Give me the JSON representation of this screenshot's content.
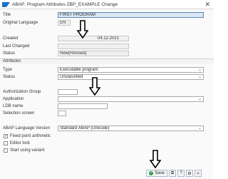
{
  "window": {
    "title": "ABAP: Program Attributes ZBP_EXAMPLE Change",
    "close": "✕"
  },
  "header": {
    "title_label": "Title",
    "title_value": "FIRST PROGRAM",
    "orig_lang_label": "Original Language",
    "orig_lang_value": "EN",
    "created_label": "Created",
    "created_date": "04.12.2021",
    "last_changed_label": "Last Changed",
    "status_label": "Status",
    "status_value": "New(Revised)"
  },
  "attributes": {
    "section_label": "Attributes",
    "type_label": "Type",
    "type_value": "Executable program",
    "status_label": "Status",
    "status_value": "Unclassified",
    "auth_group_label": "Authorization Group",
    "application_label": "Application",
    "ldb_label": "LDB name",
    "selection_screen_label": "Selection screen",
    "abap_version_label": "ABAP Language Version",
    "abap_version_value": "Standard ABAP (Unicode)",
    "fixed_point_label": "Fixed point arithmetic",
    "editor_lock_label": "Editor lock",
    "start_variant_label": "Start using variant"
  },
  "footer": {
    "save_label": "Save"
  },
  "colors": {
    "accent": "#5b89b7",
    "title_field_bg": "#dbe7f3",
    "save_check": "#2e9c3f"
  },
  "icons": [
    "sap-logo-icon",
    "close-icon",
    "dropdown-icon",
    "down-arrow-icon",
    "check-icon",
    "copy-icon",
    "help-icon",
    "cancel-icon"
  ]
}
